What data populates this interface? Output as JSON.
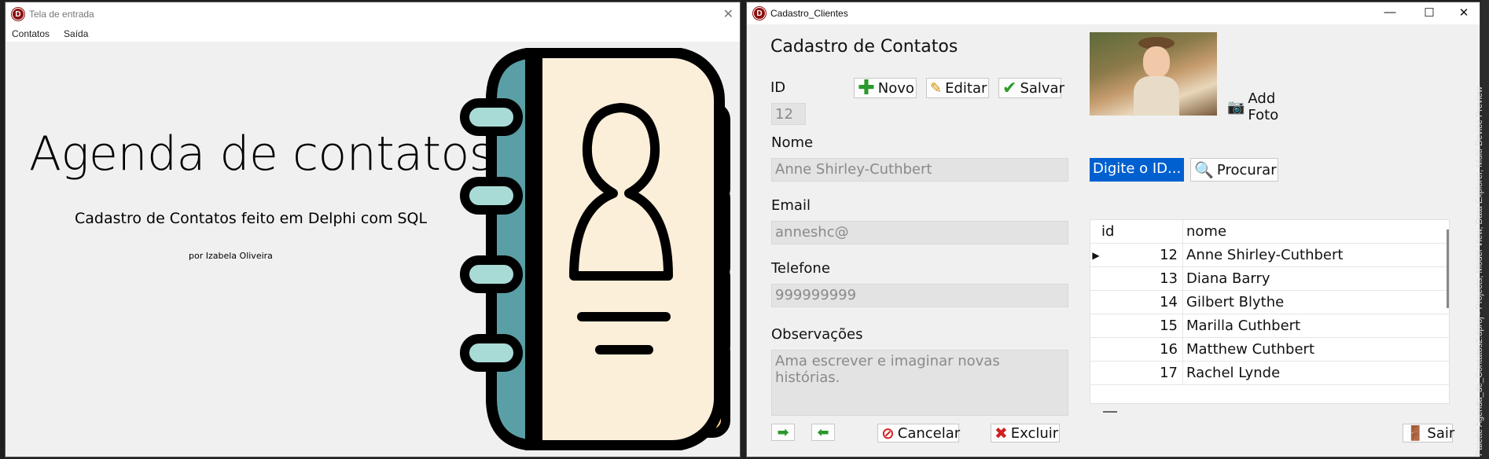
{
  "win1": {
    "title": "Tela de entrada",
    "menu": [
      "Contatos",
      "Saída"
    ],
    "heading": "Agenda de contatos",
    "subtitle": "Cadastro de Contatos feito em Delphi com SQL",
    "author": "por Izabela Oliveira"
  },
  "win2": {
    "title": "Cadastro_Clientes",
    "heading": "Cadastro de Contatos",
    "buttons": {
      "novo": "Novo",
      "editar": "Editar",
      "salvar": "Salvar",
      "add_foto": "Add Foto",
      "procurar": "Procurar",
      "cancelar": "Cancelar",
      "excluir": "Excluir",
      "sair": "Sair"
    },
    "labels": {
      "id": "ID",
      "nome": "Nome",
      "email": "Email",
      "telefone": "Telefone",
      "observacoes": "Observações"
    },
    "values": {
      "id": "12",
      "nome": "Anne Shirley-Cuthbert",
      "email": "anneshc@",
      "telefone": "999999999",
      "observacoes": "Ama escrever e imaginar novas histórias."
    },
    "search_text": "Digite o ID...",
    "grid": {
      "columns": [
        "id",
        "nome"
      ],
      "rows": [
        {
          "id": "12",
          "nome": "Anne Shirley-Cuthbert"
        },
        {
          "id": "13",
          "nome": "Diana Barry"
        },
        {
          "id": "14",
          "nome": "Gilbert Blythe"
        },
        {
          "id": "15",
          "nome": "Marilla Cuthbert"
        },
        {
          "id": "16",
          "nome": "Matthew Cuthbert"
        },
        {
          "id": "17",
          "nome": "Rachel Lynde"
        }
      ]
    }
  },
  "ide_side_text": "Palette   Agenda_de_Contatos2.dproj - Projects, Model View, Data Explorer, Multi-Device Preview",
  "colors": {
    "book_teal": "#5a9fa5",
    "book_page": "#fcefd9",
    "tab_orange": "#f99a55",
    "tab_pink": "#f77a8e",
    "tab_yellow": "#fdd28c",
    "app_icon": "#8b1010",
    "selection": "#0060d0"
  }
}
